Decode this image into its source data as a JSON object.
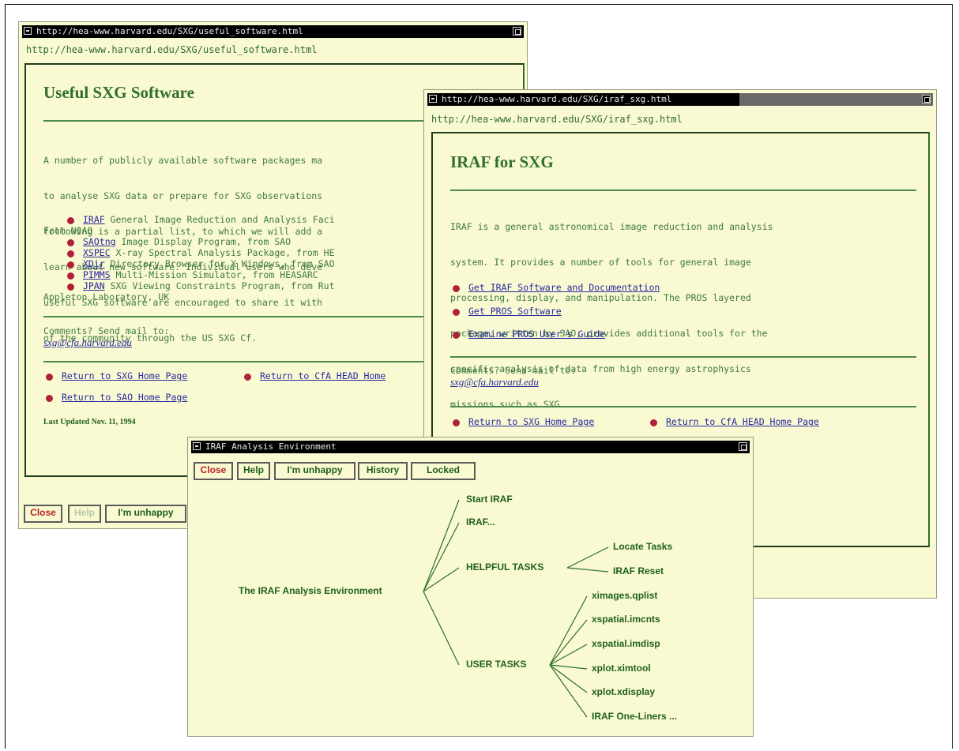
{
  "colors": {
    "window_bg": "#fafad2",
    "text_green": "#2e6e2e",
    "link_blue": "#2828a0",
    "bullet_red": "#b0203a",
    "titlebar": "#000000"
  },
  "window1": {
    "title": "http://hea-www.harvard.edu/SXG/useful_software.html",
    "url": "http://hea-www.harvard.edu/SXG/useful_software.html",
    "heading": "Useful SXG Software",
    "intro": [
      "A number of publicly available software packages ma",
      "to analyse SXG data or prepare for SXG observations",
      "following is a partial list, to which we will add a",
      "learn about new software. Individual users who deve",
      "useful SXG software are encouraged to share it with",
      "of the community through the US SXG Cf."
    ],
    "items": [
      {
        "link": "IRAF",
        "text": " General Image Reduction and Analysis Faci"
      },
      {
        "link": "",
        "text": "From NOAO"
      },
      {
        "link": "SAOtng",
        "text": " Image Display Program, from SAO"
      },
      {
        "link": "XSPEC",
        "text": " X-ray Spectral Analysis Package, from HE"
      },
      {
        "link": "XDir",
        "text": " Directory Browser for X Windows, from SAO"
      },
      {
        "link": "PIMMS",
        "text": " Multi-Mission Simulator, from HEASARC"
      },
      {
        "link": "JPAN",
        "text": " SXG Viewing Constraints Program, from Rut"
      },
      {
        "link": "",
        "text": "Appleton Laboratory, UK"
      }
    ],
    "comments": "Comments? Send mail to:",
    "email": "sxg@cfa.harvard.edu",
    "return_sxg": "Return to SXG Home Page",
    "return_cfa": "Return to CfA HEAD Home",
    "return_sao": "Return to SAO Home Page",
    "updated": "Last Updated Nov. 11, 1994",
    "buttons": {
      "close": "Close",
      "help": "Help",
      "unhappy": "I'm unhappy"
    }
  },
  "window2": {
    "title": "http://hea-www.harvard.edu/SXG/iraf_sxg.html",
    "url": "http://hea-www.harvard.edu/SXG/iraf_sxg.html",
    "heading": "IRAF for SXG",
    "intro": [
      "IRAF is a general astronomical image reduction and analysis",
      "system. It provides a number of tools for general image",
      "processing, display, and manipulation. The PROS layered",
      "package, written by SAO, provides additional tools for the",
      "specific analysis of data from high energy astrophysics",
      "missions such as SXG."
    ],
    "links": [
      "Get IRAF Software and Documentation",
      "Get PROS Software",
      "Examine PROS User's Guide"
    ],
    "comments": "Comments? Send mail to:",
    "email": "sxg@cfa.harvard.edu",
    "return_sxg": "Return to SXG Home Page",
    "return_cfa": "Return to CfA HEAD Home Page"
  },
  "window3": {
    "title": "IRAF Analysis Environment",
    "buttons": {
      "close": "Close",
      "help": "Help",
      "unhappy": "I'm unhappy",
      "history": "History",
      "locked": "Locked"
    },
    "tree": {
      "root": "The IRAF Analysis Environment",
      "level1": [
        "Start IRAF",
        "IRAF...",
        "HELPFUL TASKS",
        "USER TASKS"
      ],
      "helpful": [
        "Locate Tasks",
        "IRAF Reset"
      ],
      "user": [
        "ximages.qplist",
        "xspatial.imcnts",
        "xspatial.imdisp",
        "xplot.ximtool",
        "xplot.xdisplay",
        "IRAF One-Liners ..."
      ]
    }
  }
}
